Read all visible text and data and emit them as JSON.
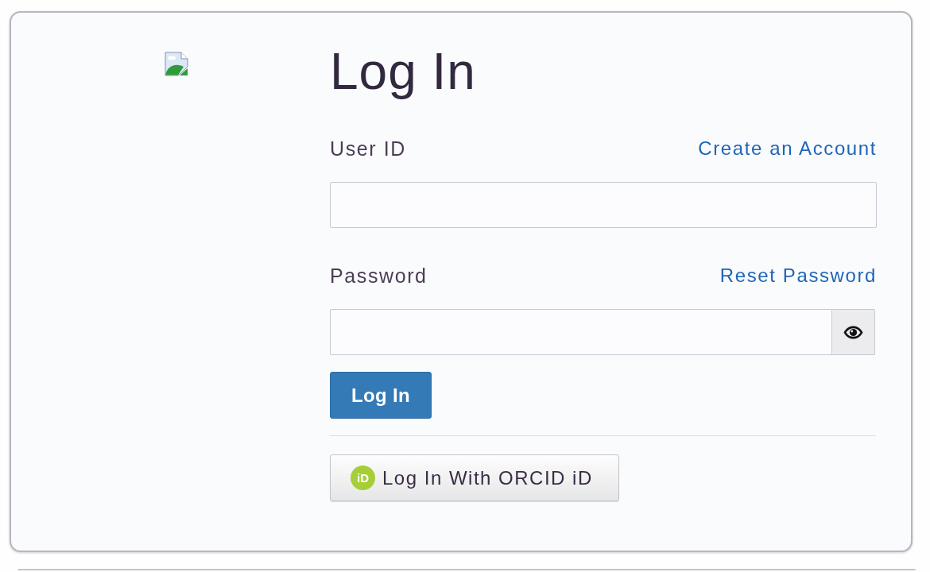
{
  "title": "Log In",
  "fields": [
    {
      "kind": "text",
      "label": "User ID",
      "link": "Create an Account"
    },
    {
      "kind": "password",
      "label": "Password",
      "link": "Reset Password"
    }
  ],
  "submit_button": "Log In",
  "orcid_button": {
    "logo": "iD",
    "label": "Log In With ORCID iD"
  }
}
